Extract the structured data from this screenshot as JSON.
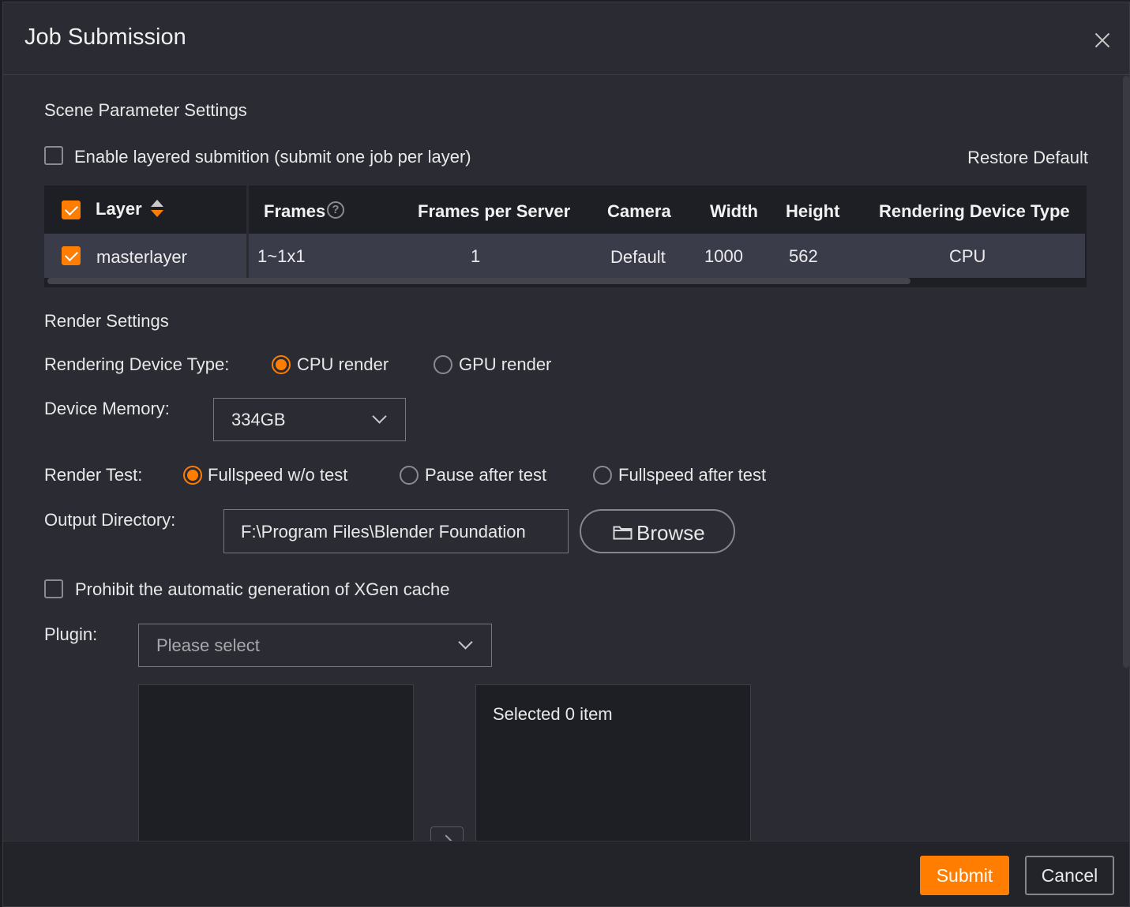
{
  "dialog": {
    "title": "Job Submission"
  },
  "scene": {
    "section_title": "Scene Parameter Settings",
    "layered_label": "Enable layered submition (submit one job per layer)",
    "layered_checked": false,
    "restore_default": "Restore Default"
  },
  "table": {
    "headers": {
      "layer": "Layer",
      "frames": "Frames",
      "frames_per_server": "Frames per Server",
      "camera": "Camera",
      "width": "Width",
      "height": "Height",
      "device_type": "Rendering Device Type"
    },
    "header_checked": true,
    "rows": [
      {
        "checked": true,
        "layer": "masterlayer",
        "frames": "1~1x1",
        "frames_per_server": "1",
        "camera": "Default",
        "width": "1000",
        "height": "562",
        "device_type": "CPU"
      }
    ]
  },
  "render": {
    "section_title": "Render Settings",
    "device_type_label": "Rendering Device Type:",
    "cpu_option": "CPU render",
    "gpu_option": "GPU render",
    "selected_device": "CPU render",
    "memory_label": "Device Memory:",
    "memory_value": "334GB",
    "test_label": "Render Test:",
    "test_options": [
      "Fullspeed w/o test",
      "Pause after test",
      "Fullspeed after test"
    ],
    "selected_test": "Fullspeed w/o test",
    "output_label": "Output Directory:",
    "output_value": "F:\\Program Files\\Blender Foundation",
    "browse_label": "Browse",
    "xgen_label": "Prohibit the automatic generation of XGen cache",
    "xgen_checked": false,
    "plugin_label": "Plugin:",
    "plugin_placeholder": "Please select",
    "selected_count_label": "Selected 0 item"
  },
  "footer": {
    "submit_label": "Submit",
    "cancel_label": "Cancel"
  },
  "colors": {
    "accent": "#ff7d00",
    "background": "#2b2c33",
    "table_row": "#3b3c4a"
  },
  "icons": [
    "close-icon",
    "sort-icon",
    "help-icon",
    "chevron-down-icon",
    "folder-icon",
    "chevron-right-icon"
  ]
}
